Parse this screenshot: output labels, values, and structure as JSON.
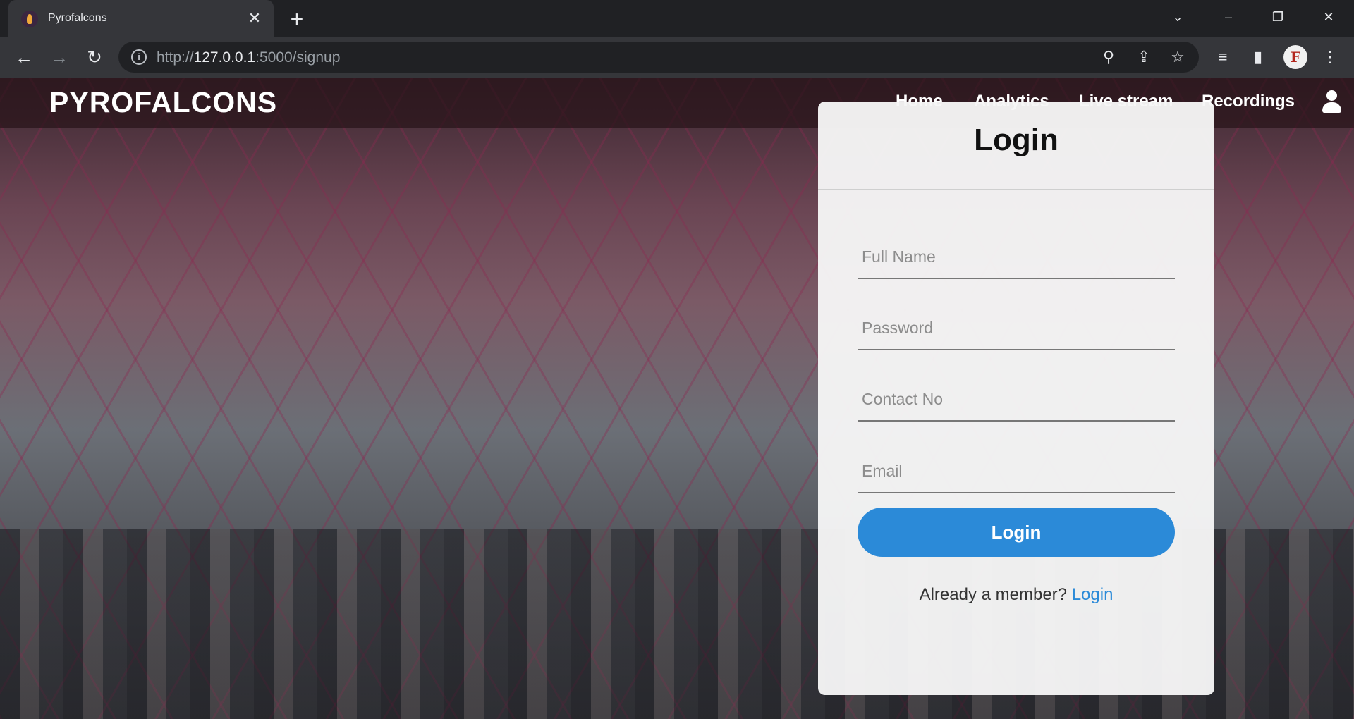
{
  "browser": {
    "tab_title": "Pyrofalcons",
    "url_prefix": "http://",
    "url_host": "127.0.0.1",
    "url_rest": ":5000/signup",
    "icons": [
      "back-icon",
      "forward-icon",
      "reload-icon",
      "info-icon",
      "zoom-icon",
      "share-icon",
      "star-icon",
      "media-icon",
      "sidepanel-icon",
      "profile-avatar",
      "menu-icon"
    ]
  },
  "navbar": {
    "brand": "PYROFALCONS",
    "links": [
      "Home",
      "Analytics",
      "Live stream",
      "Recordings"
    ]
  },
  "form": {
    "title": "Login",
    "fields": {
      "full_name": "Full Name",
      "password": "Password",
      "contact": "Contact No",
      "email": "Email"
    },
    "submit_label": "Login",
    "member_text": "Already a member?",
    "member_link": "Login"
  },
  "colors": {
    "accent": "#2b8ad8",
    "browser_dark": "#202124",
    "browser_toolbar": "#35363a"
  }
}
